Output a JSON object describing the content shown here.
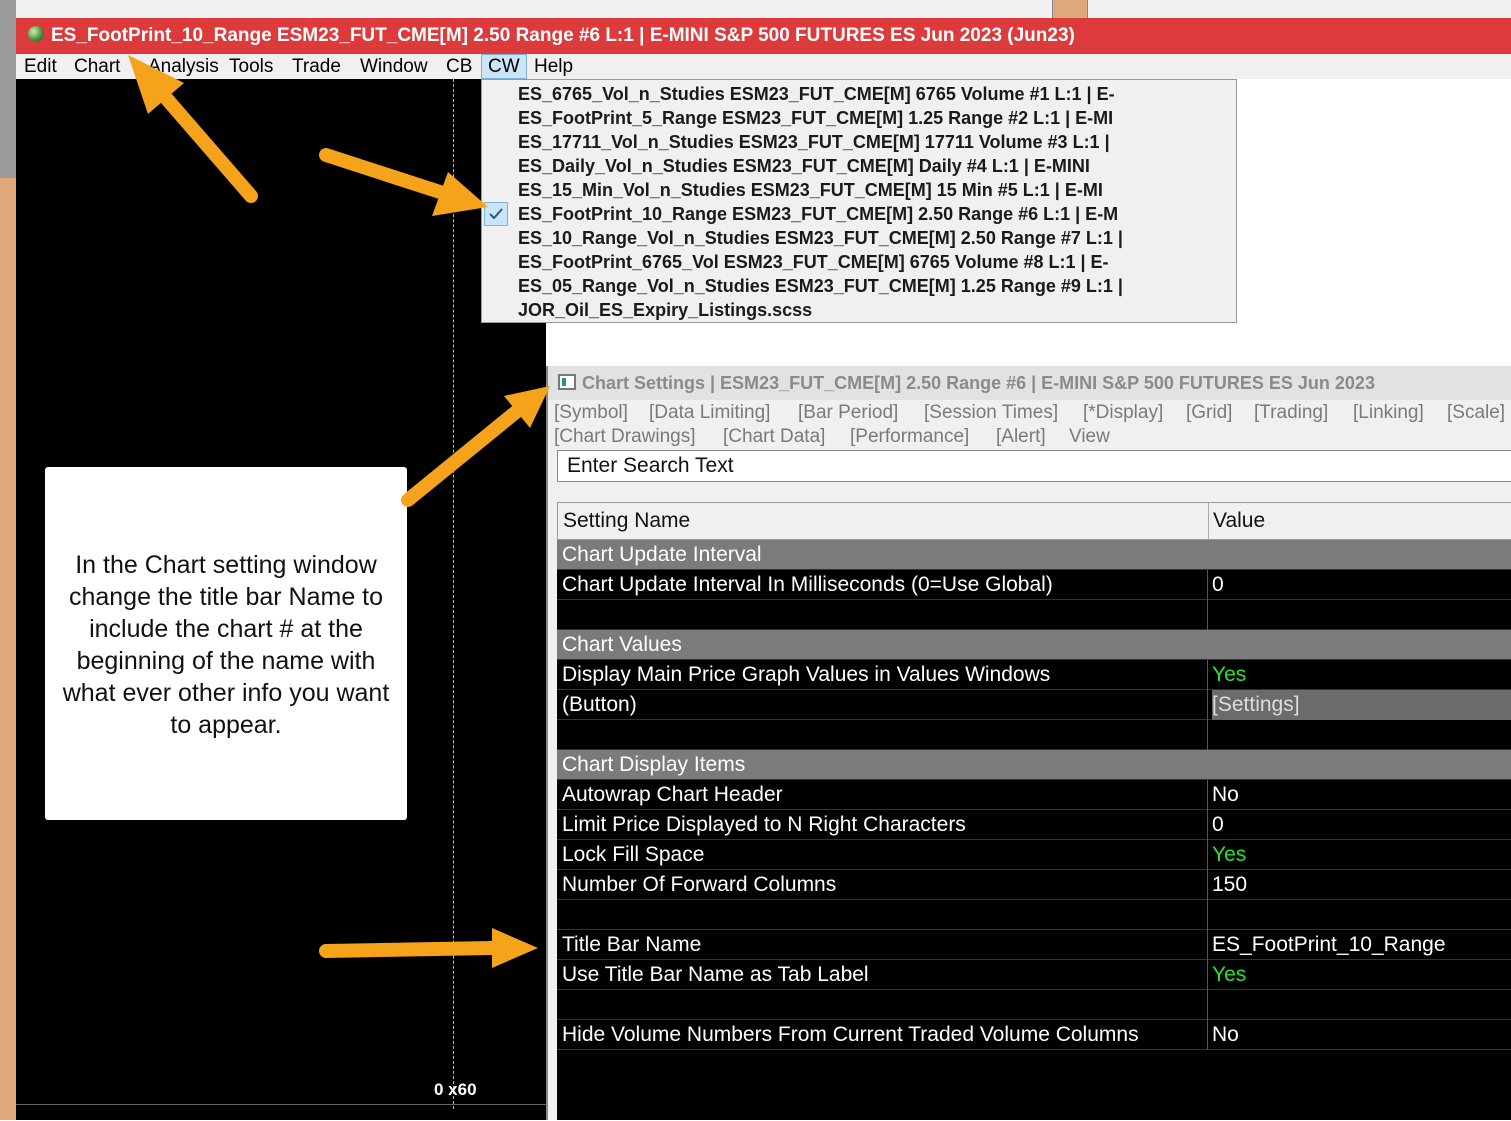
{
  "window_title": "ES_FootPrint_10_Range ESM23_FUT_CME[M]  2.50 Range  #6 L:1 | E-MINI S&P 500 FUTURES ES Jun 2023 (Jun23)",
  "menu": {
    "items": [
      "Edit",
      "Chart",
      "Analysis",
      "Tools",
      "Trade",
      "Window",
      "CB",
      "CW",
      "Help"
    ],
    "active": "CW"
  },
  "cw_menu": {
    "items": [
      "ES_6765_Vol_n_Studies ESM23_FUT_CME[M]  6765 Volume  #1 L:1 | E-",
      "ES_FootPrint_5_Range ESM23_FUT_CME[M]  1.25 Range  #2 L:1 | E-MI",
      "ES_17711_Vol_n_Studies ESM23_FUT_CME[M]  17711 Volume  #3 L:1 |",
      "ES_Daily_Vol_n_Studies ESM23_FUT_CME[M]  Daily  #4 L:1 | E-MINI",
      "ES_15_Min_Vol_n_Studies ESM23_FUT_CME[M]  15 Min  #5 L:1 | E-MI",
      "ES_FootPrint_10_Range ESM23_FUT_CME[M]  2.50 Range  #6 L:1 | E-M",
      "ES_10_Range_Vol_n_Studies ESM23_FUT_CME[M]  2.50 Range  #7 L:1 |",
      "ES_FootPrint_6765_Vol ESM23_FUT_CME[M]  6765 Volume  #8 L:1 | E-",
      "ES_05_Range_Vol_n_Studies ESM23_FUT_CME[M]  1.25 Range  #9 L:1 |",
      "JOR_Oil_ES_Expiry_Listings.scss"
    ],
    "checked_index": 5
  },
  "chart": {
    "price_label": "0 x60"
  },
  "callout": {
    "text": "In the Chart setting window change the title bar Name to include the chart # at the beginning of the name with what ever other info you want to appear."
  },
  "settings": {
    "title": "Chart Settings | ESM23_FUT_CME[M]  2.50 Range  #6 | E-MINI S&P 500 FUTURES ES Jun 2023",
    "tabs_row1": [
      "[Symbol]",
      "[Data Limiting]",
      "[Bar Period]",
      "[Session Times]",
      "[*Display]",
      "[Grid]",
      "[Trading]",
      "[Linking]",
      "[Scale]"
    ],
    "tabs_row2": [
      "[Chart Drawings]",
      "[Chart Data]",
      "[Performance]",
      "[Alert]",
      "View"
    ],
    "search_placeholder": "Enter Search Text",
    "columns": [
      "Setting Name",
      "Value"
    ],
    "rows": [
      {
        "name": "Chart Update Interval",
        "value": "",
        "type": "section"
      },
      {
        "name": "Chart Update Interval In Milliseconds (0=Use Global)",
        "value": "0",
        "type": "row"
      },
      {
        "name": "",
        "value": "",
        "type": "blank"
      },
      {
        "name": "Chart Values",
        "value": "",
        "type": "section"
      },
      {
        "name": "Display Main Price Graph Values in Values Windows",
        "value": "Yes",
        "type": "row"
      },
      {
        "name": " (Button)",
        "value": "[Settings]",
        "type": "button"
      },
      {
        "name": "",
        "value": "",
        "type": "blank"
      },
      {
        "name": "Chart Display Items",
        "value": "",
        "type": "section"
      },
      {
        "name": "Autowrap Chart Header",
        "value": "No",
        "type": "row"
      },
      {
        "name": "Limit Price Displayed to N Right Characters",
        "value": "0",
        "type": "row"
      },
      {
        "name": "Lock Fill Space",
        "value": "Yes",
        "type": "row"
      },
      {
        "name": "Number Of Forward Columns",
        "value": "150",
        "type": "row"
      },
      {
        "name": "",
        "value": "",
        "type": "blank"
      },
      {
        "name": "Title Bar Name",
        "value": "ES_FootPrint_10_Range",
        "type": "row"
      },
      {
        "name": "Use Title Bar Name as Tab Label",
        "value": "Yes",
        "type": "row"
      },
      {
        "name": "",
        "value": "",
        "type": "blank"
      },
      {
        "name": "Hide Volume Numbers From Current Traded Volume Columns",
        "value": "No",
        "type": "row"
      }
    ]
  },
  "colors": {
    "title_bar": "#dc3a3b",
    "yes_value": "#2ee02e",
    "arrow": "#f5a31a"
  }
}
